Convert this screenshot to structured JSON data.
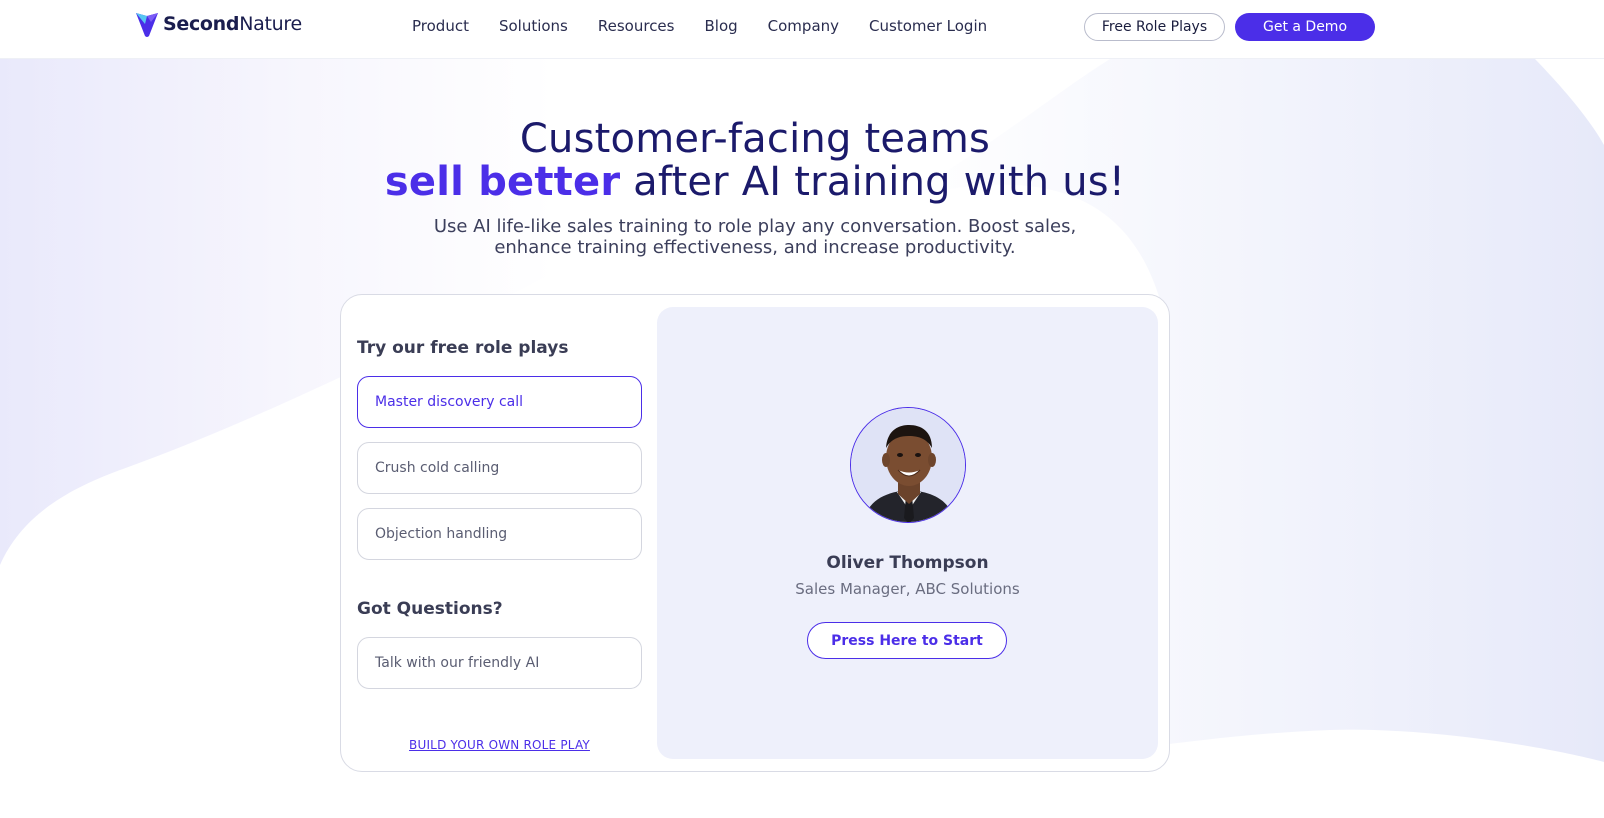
{
  "brand": {
    "name_bold": "Second",
    "name_regular": "Nature",
    "colors": {
      "primary": "#4b2ee8",
      "navy": "#1b1a6b",
      "panel": "#eef0fb"
    }
  },
  "nav": {
    "items": [
      "Product",
      "Solutions",
      "Resources",
      "Blog",
      "Company",
      "Customer Login"
    ],
    "free_role_plays": "Free Role Plays",
    "get_demo": "Get a Demo"
  },
  "hero": {
    "line1": "Customer-facing teams",
    "accent": "sell better",
    "line2_rest": " after AI training with us!",
    "sub_line1": "Use AI life-like sales training to role play any conversation. Boost sales,",
    "sub_line2": "enhance training effectiveness, and increase productivity."
  },
  "roleplays": {
    "title": "Try our free role plays",
    "options": [
      "Master discovery call",
      "Crush cold calling",
      "Objection handling"
    ],
    "selected": "Master discovery call"
  },
  "questions": {
    "title": "Got Questions?",
    "option": "Talk with our friendly AI"
  },
  "build_link": "BUILD YOUR OWN ROLE PLAY",
  "persona": {
    "name": "Oliver Thompson",
    "role": "Sales Manager, ABC Solutions",
    "start": "Press Here to Start",
    "avatar_icon": "person-portrait"
  }
}
